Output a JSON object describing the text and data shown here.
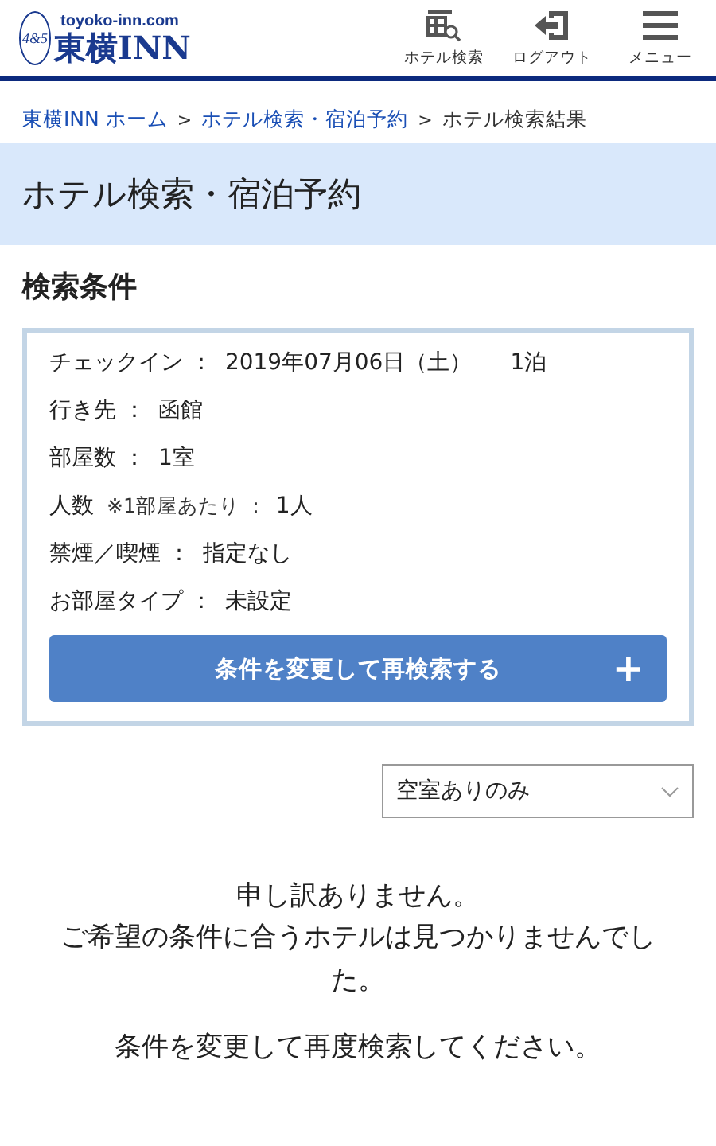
{
  "header": {
    "logo_mark": "4&5",
    "logo_domain": "toyoko-inn.com",
    "logo_name": "東横INN",
    "nav": [
      {
        "kind": "search",
        "label": "ホテル検索"
      },
      {
        "kind": "logout",
        "label": "ログアウト"
      },
      {
        "kind": "menu",
        "label": "メニュー"
      }
    ]
  },
  "breadcrumb_separator": ">",
  "breadcrumb": [
    {
      "label": "東横INN ホーム",
      "link": true
    },
    {
      "label": "ホテル検索・宿泊予約",
      "link": true
    },
    {
      "label": "ホテル検索結果",
      "link": false
    }
  ],
  "banner": {
    "title": "ホテル検索・宿泊予約"
  },
  "conditions": {
    "title": "検索条件",
    "rows": [
      {
        "label": "チェックイン ：",
        "value": "2019年07月06日（土）",
        "extra": "1泊"
      },
      {
        "label": "行き先 ：",
        "value": "函館"
      },
      {
        "label": "部屋数 ：",
        "value": "1室"
      },
      {
        "label": "人数",
        "note": "※1部屋あたり ：",
        "value": "1人"
      },
      {
        "label": "禁煙／喫煙 ：",
        "value": "指定なし"
      },
      {
        "label": "お部屋タイプ ：",
        "value": "未設定"
      }
    ],
    "button": {
      "label": "条件を変更して再検索する",
      "icon": "+"
    }
  },
  "filter": {
    "value": "空室ありのみ"
  },
  "message": {
    "lines": [
      "申し訳ありません。",
      "ご希望の条件に合うホテルは見つかりませんでした。"
    ],
    "hint": "条件を変更して再度検索してください。"
  }
}
